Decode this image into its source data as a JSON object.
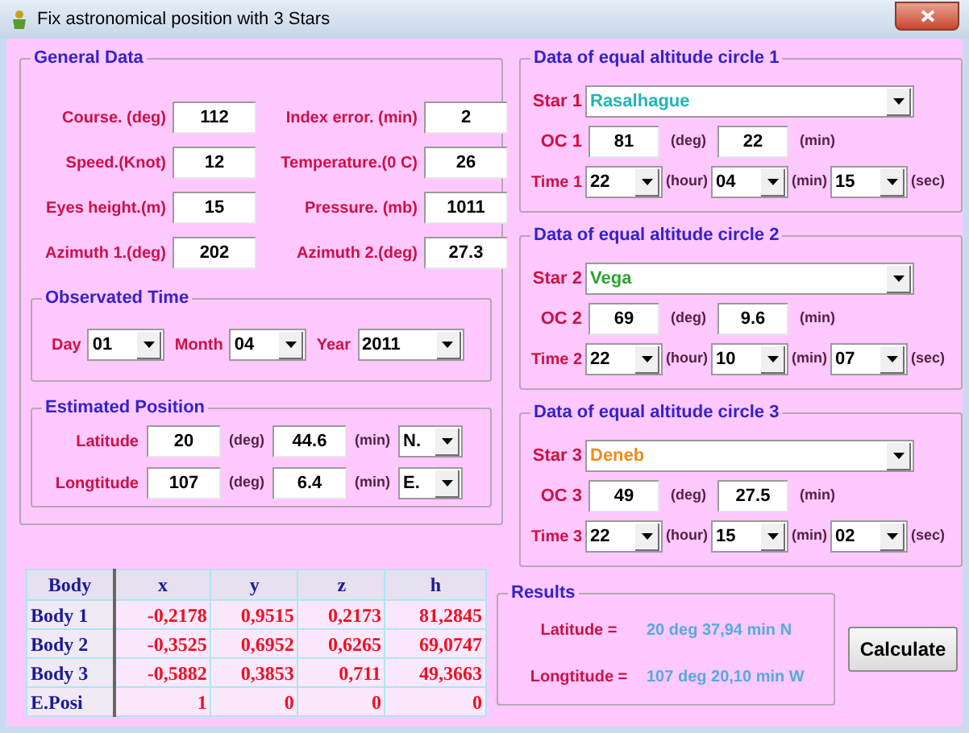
{
  "window": {
    "title": "Fix astronomical position with 3 Stars"
  },
  "general_data": {
    "title": "General Data",
    "fields": [
      {
        "label": "Course. (deg)",
        "value": "112"
      },
      {
        "label": "Index error. (min)",
        "value": "2"
      },
      {
        "label": "Speed.(Knot)",
        "value": "12"
      },
      {
        "label": "Temperature.(0 C)",
        "value": "26"
      },
      {
        "label": "Eyes height.(m)",
        "value": "15"
      },
      {
        "label": "Pressure. (mb)",
        "value": "1011"
      },
      {
        "label": "Azimuth 1.(deg)",
        "value": "202"
      },
      {
        "label": "Azimuth 2.(deg)",
        "value": "27.3"
      }
    ]
  },
  "observed_time": {
    "title": "Observated Time",
    "fields": [
      {
        "label": "Day",
        "value": "01"
      },
      {
        "label": "Month",
        "value": "04"
      },
      {
        "label": "Year",
        "value": "2011"
      }
    ]
  },
  "estimated_position": {
    "title": "Estimated Position",
    "rows": [
      {
        "label": "Latitude",
        "deg": "20",
        "deg_unit": "(deg)",
        "min": "44.6",
        "min_unit": "(min)",
        "hemisphere": "N."
      },
      {
        "label": "Longtitude",
        "deg": "107",
        "deg_unit": "(deg)",
        "min": "6.4",
        "min_unit": "(min)",
        "hemisphere": "E."
      }
    ]
  },
  "circles": [
    {
      "title": "Data of equal altitude circle 1",
      "star_label": "Star 1",
      "star": "Rasalhague",
      "color": "#22b4b4",
      "oc_label": "OC 1",
      "deg": "81",
      "deg_unit": "(deg)",
      "min": "22",
      "min_unit": "(min)",
      "time_label": "Time 1",
      "hour": "22",
      "hour_unit": "(hour)",
      "minute": "04",
      "minute_unit": "(min)",
      "second": "15",
      "second_unit": "(sec)"
    },
    {
      "title": "Data of equal altitude circle 2",
      "star_label": "Star 2",
      "star": "Vega",
      "color": "#2aa52a",
      "oc_label": "OC 2",
      "deg": "69",
      "deg_unit": "(deg)",
      "min": "9.6",
      "min_unit": "(min)",
      "time_label": "Time 2",
      "hour": "22",
      "hour_unit": "(hour)",
      "minute": "10",
      "minute_unit": "(min)",
      "second": "07",
      "second_unit": "(sec)"
    },
    {
      "title": "Data of equal altitude circle 3",
      "star_label": "Star 3",
      "star": "Deneb",
      "color": "#f08c14",
      "oc_label": "OC 3",
      "deg": "49",
      "deg_unit": "(deg)",
      "min": "27.5",
      "min_unit": "(min)",
      "time_label": "Time 3",
      "hour": "22",
      "hour_unit": "(hour)",
      "minute": "15",
      "minute_unit": "(min)",
      "second": "02",
      "second_unit": "(sec)"
    }
  ],
  "table": {
    "columns": [
      "Body",
      "x",
      "y",
      "z",
      "h"
    ],
    "rows": [
      [
        "Body 1",
        "-0,2178",
        "0,9515",
        "0,2173",
        "81,2845"
      ],
      [
        "Body 2",
        "-0,3525",
        "0,6952",
        "0,6265",
        "69,0747"
      ],
      [
        "Body 3",
        "-0,5882",
        "0,3853",
        "0,711",
        "49,3663"
      ],
      [
        "E.Posi",
        "1",
        "0",
        "0",
        "0"
      ]
    ]
  },
  "results": {
    "title": "Results",
    "rows": [
      {
        "label": "Latitude =",
        "value": "20 deg 37,94 min N"
      },
      {
        "label": "Longtitude =",
        "value": "107 deg 20,10 min W"
      }
    ]
  },
  "calculate_button": "Calculate"
}
